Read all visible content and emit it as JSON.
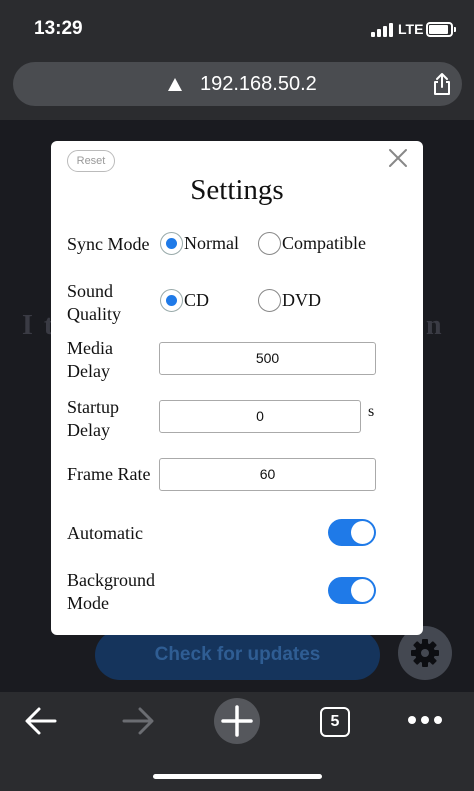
{
  "status": {
    "time": "13:29",
    "network": "LTE"
  },
  "browser": {
    "url": "192.168.50.2",
    "tab_count": "5"
  },
  "background": {
    "title_left": "I t",
    "title_right": "n",
    "update_button": "Check for updates"
  },
  "modal": {
    "reset_label": "Reset",
    "title": "Settings",
    "sync_mode": {
      "label": "Sync Mode",
      "options": [
        "Normal",
        "Compatible"
      ],
      "selected": "Normal"
    },
    "sound_quality": {
      "label_line1": "Sound",
      "label_line2": "Quality",
      "options": [
        "CD",
        "DVD"
      ],
      "selected": "CD"
    },
    "media_delay": {
      "label_line1": "Media",
      "label_line2": "Delay",
      "value": "500"
    },
    "startup_delay": {
      "label_line1": "Startup",
      "label_line2": "Delay",
      "value": "0",
      "unit": "s"
    },
    "frame_rate": {
      "label": "Frame Rate",
      "value": "60"
    },
    "automatic": {
      "label": "Automatic",
      "on": true
    },
    "background_mode": {
      "label_line1": "Background",
      "label_line2": "Mode",
      "on": true
    }
  },
  "colors": {
    "accent": "#1f7ae8",
    "chrome": "#2b2c2f",
    "page_bg": "#1a1b20"
  },
  "icons": [
    "warning-icon",
    "share-icon",
    "close-icon",
    "gear-icon",
    "back-arrow-icon",
    "forward-arrow-icon",
    "plus-icon",
    "tabs-icon",
    "more-icon"
  ]
}
